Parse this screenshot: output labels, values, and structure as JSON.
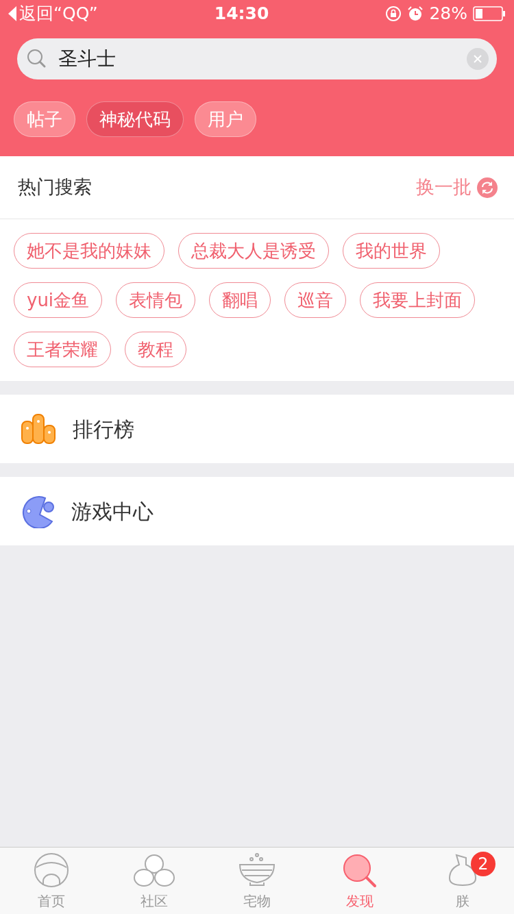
{
  "status_bar": {
    "back": "返回“QQ”",
    "time": "14:30",
    "battery": "28%"
  },
  "search": {
    "value": "圣斗士"
  },
  "tabs": [
    {
      "label": "帖子",
      "selected": false
    },
    {
      "label": "神秘代码",
      "selected": true
    },
    {
      "label": "用户",
      "selected": false
    }
  ],
  "hot_search": {
    "title": "热门搜索",
    "refresh": "换一批",
    "tags": [
      "她不是我的妹妹",
      "总裁大人是诱受",
      "我的世界",
      "yui金鱼",
      "表情包",
      "翻唱",
      "巡音",
      "我要上封面",
      "王者荣耀",
      "教程"
    ]
  },
  "entries": [
    {
      "kind": "ranking",
      "label": "排行榜"
    },
    {
      "kind": "game",
      "label": "游戏中心"
    }
  ],
  "tab_bar": [
    {
      "kind": "home",
      "label": "首页",
      "selected": false
    },
    {
      "kind": "community",
      "label": "社区",
      "selected": false
    },
    {
      "kind": "bowl",
      "label": "宅物",
      "selected": false
    },
    {
      "kind": "discover",
      "label": "发现",
      "selected": true
    },
    {
      "kind": "me",
      "label": "朕",
      "selected": false,
      "badge": "2"
    }
  ]
}
